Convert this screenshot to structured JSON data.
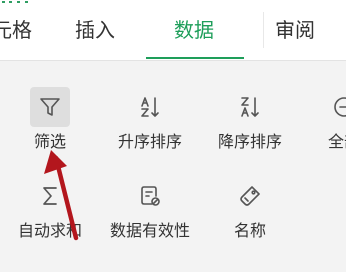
{
  "tabs": [
    {
      "label": "元格"
    },
    {
      "label": "插入"
    },
    {
      "label": "数据"
    },
    {
      "label": "审阅"
    }
  ],
  "active_tab": "数据",
  "tools": [
    {
      "label": "筛选",
      "icon": "filter-icon"
    },
    {
      "label": "升序排序",
      "icon": "sort-ascending-icon"
    },
    {
      "label": "降序排序",
      "icon": "sort-descending-icon"
    },
    {
      "label": "全部",
      "icon": "show-all-icon"
    },
    {
      "label": "自动求和",
      "icon": "sum-icon"
    },
    {
      "label": "数据有效性",
      "icon": "data-validation-icon"
    },
    {
      "label": "名称",
      "icon": "name-tag-icon"
    }
  ],
  "colors": {
    "accent": "#1e9e5a",
    "annotation_arrow": "#b3161d",
    "panel_bg": "#f3f3f3",
    "tab_bg": "#ffffff"
  }
}
